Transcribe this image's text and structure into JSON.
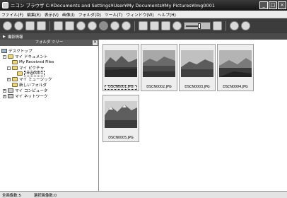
{
  "window": {
    "title": "ニコン ブラウザ  C:¥Documents and Settings¥User¥My Documents¥My Pictures¥Img0001",
    "minimize_glyph": "_",
    "maximize_glyph": "□",
    "close_glyph": "×"
  },
  "menu": [
    "ファイル(F)",
    "編集(E)",
    "表示(V)",
    "画像(I)",
    "フォルダ(D)",
    "ツール(T)",
    "ウィンドウ(W)",
    "ヘルプ(H)"
  ],
  "toolbar": {
    "icons": [
      "back-icon",
      "forward-icon",
      "folder-up-icon",
      "search-icon",
      "refresh-icon",
      "view-icon",
      "rotate-left-icon",
      "rotate-right-icon",
      "edit-icon",
      "check-icon",
      "close-icon",
      "print-icon",
      "transfer-icon",
      "mail-icon",
      "slideshow-icon",
      "thumbnail-size-slider",
      "film-strip-icon",
      "settings-icon",
      "help-icon"
    ],
    "slider_level": 0.6
  },
  "infobar": {
    "label": "撮影情報"
  },
  "tree": {
    "header": "フォルダ ツリー",
    "nodes": [
      {
        "label": "デスクトップ"
      },
      {
        "label": "マイ ドキュメント"
      },
      {
        "label": "My Received Files"
      },
      {
        "label": "マイ ピクチャ"
      },
      {
        "label": "Img0001"
      },
      {
        "label": "マイ ミュージック"
      },
      {
        "label": "新しいフォルダ"
      },
      {
        "label": "マイ コンピュータ"
      },
      {
        "label": "マイ ネットワーク"
      }
    ]
  },
  "thumbnails": [
    {
      "filename": "DSCN0001.JPG",
      "selected": true
    },
    {
      "filename": "DSCN0002.JPG",
      "selected": false
    },
    {
      "filename": "DSCN0003.JPG",
      "selected": false
    },
    {
      "filename": "DSCN0004.JPG",
      "selected": false
    },
    {
      "filename": "DSCN0005.JPG",
      "selected": false
    }
  ],
  "status": {
    "total": "全画像数:5",
    "selected": "選択画像数:0"
  }
}
